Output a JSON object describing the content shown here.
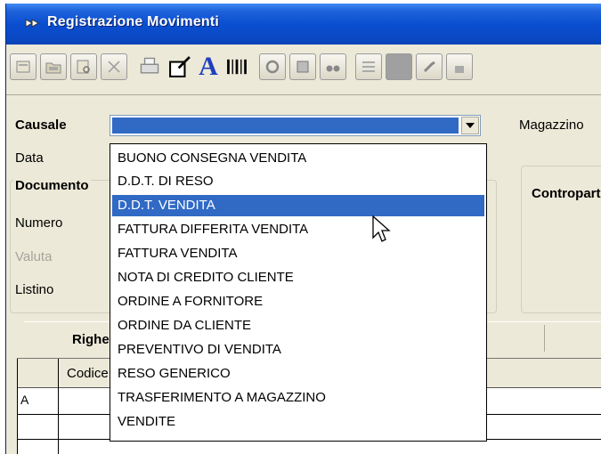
{
  "window": {
    "title": "Registrazione Movimenti"
  },
  "toolbar": {
    "icons": [
      "new-doc-icon",
      "open-folder-icon",
      "find-doc-icon",
      "delete-icon",
      "print-icon",
      "edit-icon",
      "font-icon",
      "barcode-icon",
      "refresh-icon",
      "export-icon",
      "binoculars-icon",
      "list-icon",
      "grid-icon",
      "hammer-icon",
      "lock-icon"
    ],
    "font_glyph": "A"
  },
  "form": {
    "causale_label": "Causale",
    "causale_value": "",
    "magazzino_label": "Magazzino",
    "data_label": "Data",
    "documento_group": "Documento",
    "numero_label": "Numero",
    "valuta_label": "Valuta",
    "listino_label": "Listino",
    "contropartita_group": "Contropartita"
  },
  "tabs": {
    "righe_label": "Righe"
  },
  "grid": {
    "columns": [
      "",
      "Codice"
    ],
    "rows": [
      [
        "A",
        ""
      ],
      [
        "",
        ""
      ],
      [
        "",
        ""
      ]
    ]
  },
  "dropdown": {
    "options": [
      "BUONO CONSEGNA VENDITA",
      "D.D.T. DI RESO",
      "D.D.T. VENDITA",
      "FATTURA DIFFERITA VENDITA",
      "FATTURA VENDITA",
      "NOTA DI CREDITO CLIENTE",
      "ORDINE A FORNITORE",
      "ORDINE DA CLIENTE",
      "PREVENTIVO DI VENDITA",
      "RESO GENERICO",
      "TRASFERIMENTO A MAGAZZINO",
      "VENDITE"
    ],
    "highlighted_index": 2
  },
  "colors": {
    "title_bar": "#0A4FD0",
    "selection": "#316AC5",
    "face": "#ECE9D8"
  }
}
